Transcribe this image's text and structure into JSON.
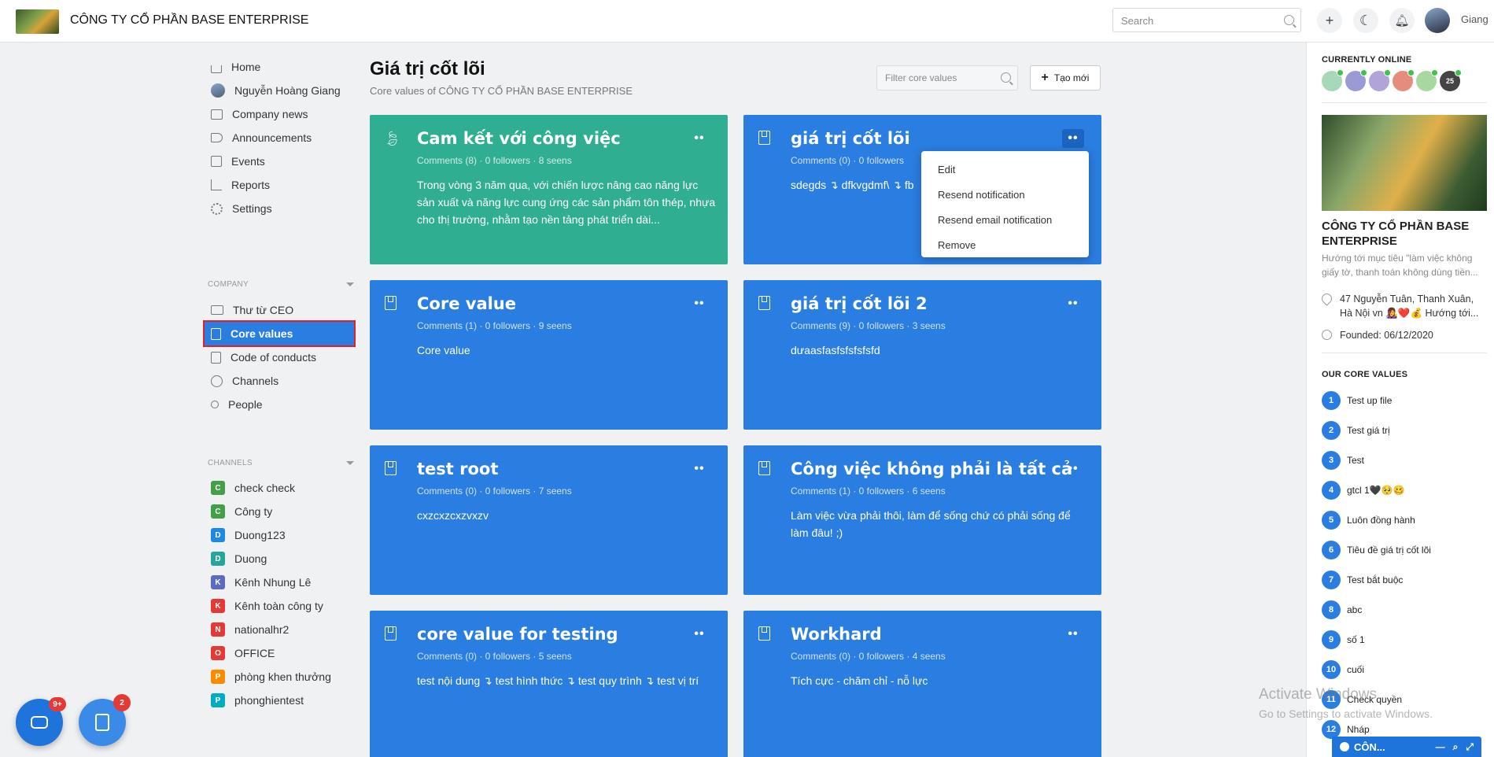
{
  "header": {
    "company_name": "CÔNG TY CỔ PHẦN BASE ENTERPRISE",
    "search_placeholder": "Search",
    "user_name": "Giang"
  },
  "nav": {
    "main": [
      {
        "label": "Home",
        "icon": "home-icon"
      },
      {
        "label": "Nguyễn Hoàng Giang",
        "icon": "avatar"
      },
      {
        "label": "Company news",
        "icon": "newspaper-icon"
      },
      {
        "label": "Announcements",
        "icon": "megaphone-icon"
      },
      {
        "label": "Events",
        "icon": "calendar-icon"
      },
      {
        "label": "Reports",
        "icon": "bar-chart-icon"
      },
      {
        "label": "Settings",
        "icon": "gear-icon"
      }
    ],
    "company_heading": "COMPANY",
    "company": [
      {
        "label": "Thư từ CEO",
        "icon": "mail-icon"
      },
      {
        "label": "Core values",
        "icon": "book-icon",
        "active": true
      },
      {
        "label": "Code of conducts",
        "icon": "book-icon"
      },
      {
        "label": "Channels",
        "icon": "globe-icon"
      },
      {
        "label": "People",
        "icon": "people-icon"
      }
    ],
    "channels_heading": "CHANNELS",
    "channels": [
      {
        "letter": "C",
        "label": "check check",
        "color": "#43a047"
      },
      {
        "letter": "C",
        "label": "Công ty",
        "color": "#43a047"
      },
      {
        "letter": "D",
        "label": "Duong123",
        "color": "#1e88e5"
      },
      {
        "letter": "D",
        "label": "Duong",
        "color": "#26a69a"
      },
      {
        "letter": "K",
        "label": "Kênh Nhung Lê",
        "color": "#5c6bc0"
      },
      {
        "letter": "K",
        "label": "Kênh toàn công ty",
        "color": "#e53935"
      },
      {
        "letter": "N",
        "label": "nationalhr2",
        "color": "#e53935"
      },
      {
        "letter": "O",
        "label": "OFFICE",
        "color": "#e53935"
      },
      {
        "letter": "P",
        "label": "phòng khen thưởng",
        "color": "#fb8c00"
      },
      {
        "letter": "P",
        "label": "phonghientest",
        "color": "#00acc1"
      }
    ]
  },
  "main": {
    "title": "Giá trị cốt lõi",
    "subtitle": "Core values of CÔNG TY CỔ PHẦN BASE ENTERPRISE",
    "filter_placeholder": "Filter core values",
    "create_label": "Tạo mới",
    "cards": [
      {
        "title": "Cam kết với công việc",
        "meta": "Comments (8) · 0 followers · 8 seens",
        "body": "Trong vòng 3 năm qua, với chiến lược nâng cao năng lực sản xuất và năng lực cung ứng các sản phẩm tôn thép, nhựa cho thị trường, nhằm tạo nền tảng phát triển dài...",
        "color": "#2fae91",
        "icon": "leaf-icon"
      },
      {
        "title": "giá trị cốt lõi",
        "meta": "Comments (0) · 0 followers",
        "body": "sdegds ↴ dfkvgdmf\\ ↴ fb",
        "color": "#2a7de1",
        "icon": "book-icon"
      },
      {
        "title": "Core value",
        "meta": "Comments (1) · 0 followers · 9 seens",
        "body": "Core value",
        "color": "#2a7de1",
        "icon": "book-icon"
      },
      {
        "title": "giá trị cốt lõi 2",
        "meta": "Comments (9) · 0 followers · 3 seens",
        "body": "dưaasfasfsfsfsfsfd",
        "color": "#2a7de1",
        "icon": "book-icon"
      },
      {
        "title": "test root",
        "meta": "Comments (0) · 0 followers · 7 seens",
        "body": "cxzcxzcxzvxzv",
        "color": "#2a7de1",
        "icon": "book-icon"
      },
      {
        "title": "Công việc không phải là tất cả",
        "meta": "Comments (1) · 0 followers · 6 seens",
        "body": "Làm việc vừa phải thôi, làm để sống chứ có phải sống để làm đâu! ;)",
        "color": "#2a7de1",
        "icon": "book-icon"
      },
      {
        "title": "core value for testing",
        "meta": "Comments (0) · 0 followers · 5 seens",
        "body": "test nội dung ↴ test hình thức ↴ test quy trình ↴ test vị trí",
        "color": "#2a7de1",
        "icon": "book-icon"
      },
      {
        "title": "Workhard",
        "meta": "Comments (0) · 0 followers · 4 seens",
        "body": "Tích cực - chăm chỉ - nỗ lực",
        "color": "#2a7de1",
        "icon": "book-icon"
      }
    ],
    "menu_button": "••",
    "dropdown": [
      "Edit",
      "Resend notification",
      "Resend email notification",
      "Remove"
    ]
  },
  "rightbar": {
    "online_heading": "CURRENTLY ONLINE",
    "online_more": "25",
    "company_name": "CÔNG TY CỔ PHẦN BASE ENTERPRISE",
    "description": "Hướng tới mục tiêu \"làm việc không giấy tờ, thanh toán không dùng tiền...",
    "address": "47 Nguyễn Tuân, Thanh Xuân, Hà Nội vn 👩‍🎤❤️💰 Hướng tới...",
    "founded": "Founded: 06/12/2020",
    "core_values_heading": "OUR CORE VALUES",
    "core_values": [
      {
        "n": "1",
        "label": "Test up file"
      },
      {
        "n": "2",
        "label": "Test giá trị"
      },
      {
        "n": "3",
        "label": "Test"
      },
      {
        "n": "4",
        "label": "gtcl 1🖤🥺🥴"
      },
      {
        "n": "5",
        "label": "Luôn đồng hành"
      },
      {
        "n": "6",
        "label": "Tiêu đề giá trị cốt lõi"
      },
      {
        "n": "7",
        "label": "Test bắt buộc"
      },
      {
        "n": "8",
        "label": "abc"
      },
      {
        "n": "9",
        "label": "số 1"
      },
      {
        "n": "10",
        "label": "cuối"
      },
      {
        "n": "11",
        "label": "Check quyền"
      },
      {
        "n": "12",
        "label": "Nháp"
      }
    ],
    "chat_label": "CÔN..."
  },
  "floating": {
    "chat_badge": "9+",
    "tasks_badge": "2"
  },
  "watermark": {
    "line1": "Activate Windows",
    "line2": "Go to Settings to activate Windows."
  }
}
